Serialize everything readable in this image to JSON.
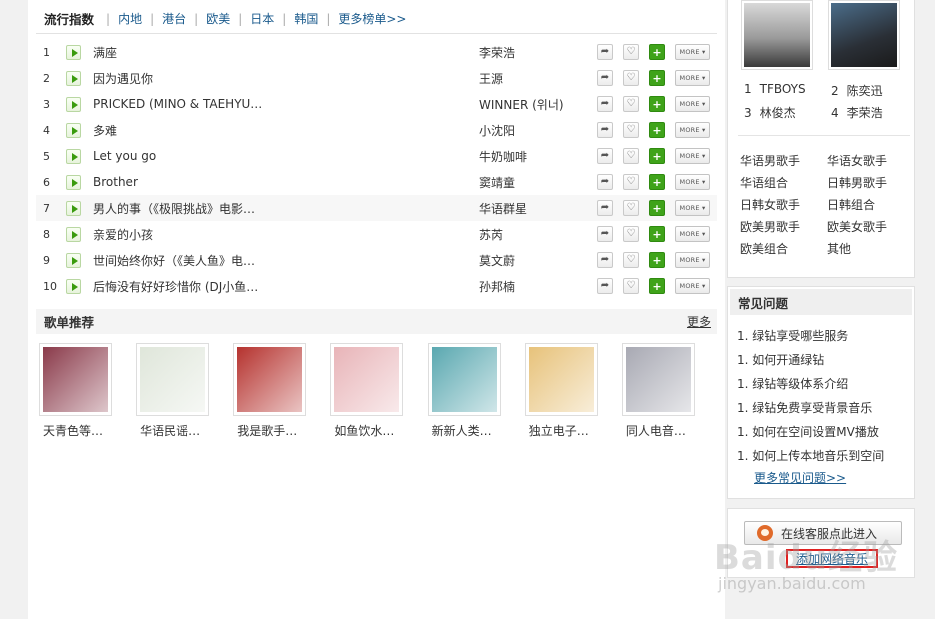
{
  "chart": {
    "title": "流行指数",
    "tabs": [
      "内地",
      "港台",
      "欧美",
      "日本",
      "韩国"
    ],
    "more_label": "更多榜单>>",
    "more_button_label": "MORE ▾",
    "songs": [
      {
        "rank": "1",
        "name": "满座",
        "artist": "李荣浩"
      },
      {
        "rank": "2",
        "name": "因为遇见你",
        "artist": "王源"
      },
      {
        "rank": "3",
        "name": "PRICKED (MINO & TAEHYU…",
        "artist": "WINNER (위너)"
      },
      {
        "rank": "4",
        "name": "多难",
        "artist": "小沈阳"
      },
      {
        "rank": "5",
        "name": "Let you go",
        "artist": "牛奶咖啡"
      },
      {
        "rank": "6",
        "name": "Brother",
        "artist": "窦靖童"
      },
      {
        "rank": "7",
        "name": "男人的事（《极限挑战》电影…",
        "artist": "华语群星"
      },
      {
        "rank": "8",
        "name": "亲爱的小孩",
        "artist": "苏芮"
      },
      {
        "rank": "9",
        "name": "世间始终你好（《美人鱼》电…",
        "artist": "莫文蔚"
      },
      {
        "rank": "10",
        "name": "后悔没有好好珍惜你 (DJ小鱼…",
        "artist": "孙邦楠"
      }
    ]
  },
  "playlists": {
    "title": "歌单推荐",
    "more_label": "更多",
    "items": [
      {
        "name": "天青色等…",
        "color": "#8a3a4a"
      },
      {
        "name": "华语民谣…",
        "color": "#dfe6da"
      },
      {
        "name": "我是歌手…",
        "color": "#b5322e"
      },
      {
        "name": "如鱼饮水…",
        "color": "#e8b4b8"
      },
      {
        "name": "新新人类…",
        "color": "#5aa8b0"
      },
      {
        "name": "独立电子…",
        "color": "#e7c27a"
      },
      {
        "name": "同人电音…",
        "color": "#a8a9b3"
      }
    ]
  },
  "artists": {
    "top": [
      {
        "rank": "1",
        "name": "TFBOYS"
      },
      {
        "rank": "2",
        "name": "陈奕迅"
      },
      {
        "rank": "3",
        "name": "林俊杰"
      },
      {
        "rank": "4",
        "name": "李荣浩"
      }
    ],
    "categories": [
      "华语男歌手",
      "华语女歌手",
      "华语组合",
      "日韩男歌手",
      "日韩女歌手",
      "日韩组合",
      "欧美男歌手",
      "欧美女歌手",
      "欧美组合",
      "其他"
    ]
  },
  "faq": {
    "title": "常见问题",
    "items": [
      "1. 绿钻享受哪些服务",
      "1. 如何开通绿钻",
      "1. 绿钻等级体系介绍",
      "1. 绿钻免费享受背景音乐",
      "1. 如何在空间设置MV播放",
      "1. 如何上传本地音乐到空间"
    ],
    "more_label": "更多常见问题>>"
  },
  "service": {
    "button_label": "在线客服点此进入",
    "join_label": "添加网络音乐"
  },
  "watermark": {
    "text": "Baidu经验",
    "url": "jingyan.baidu.com"
  }
}
